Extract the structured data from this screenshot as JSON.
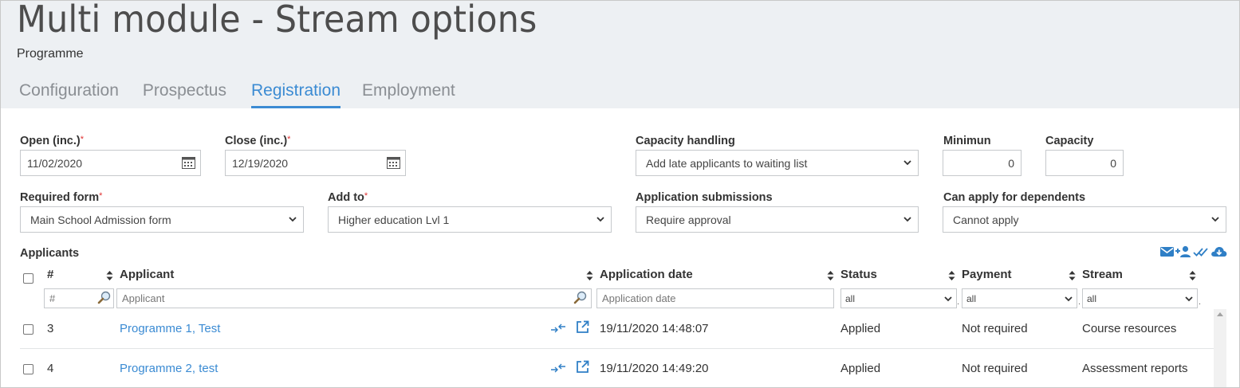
{
  "header": {
    "title": "Multi module - Stream options",
    "subtitle": "Programme",
    "tabs": [
      {
        "label": "Configuration",
        "active": false
      },
      {
        "label": "Prospectus",
        "active": false
      },
      {
        "label": "Registration",
        "active": true
      },
      {
        "label": "Employment",
        "active": false
      }
    ]
  },
  "form": {
    "open": {
      "label": "Open (inc.)",
      "required_mark": "*",
      "value": "11/02/2020"
    },
    "close": {
      "label": "Close (inc.)",
      "required_mark": "*",
      "value": "12/19/2020"
    },
    "capacity_handling": {
      "label": "Capacity handling",
      "value": "Add late applicants to waiting list"
    },
    "minimum": {
      "label": "Minimun",
      "value": "0"
    },
    "capacity": {
      "label": "Capacity",
      "value": "0"
    },
    "required_form": {
      "label": "Required form",
      "required_mark": "*",
      "value": "Main School Admission form"
    },
    "add_to": {
      "label": "Add to",
      "required_mark": "*",
      "value": "Higher education Lvl 1"
    },
    "application_submissions": {
      "label": "Application submissions",
      "value": "Require approval"
    },
    "can_apply_for_dependents": {
      "label": "Can apply for dependents",
      "value": "Cannot apply"
    }
  },
  "applicants": {
    "title": "Applicants",
    "columns": {
      "number": "#",
      "applicant": "Applicant",
      "application_date": "Application date",
      "status": "Status",
      "payment": "Payment",
      "stream": "Stream"
    },
    "filters": {
      "number_placeholder": "#",
      "applicant_placeholder": "Applicant",
      "date_placeholder": "Application date",
      "status_value": "all",
      "payment_value": "all",
      "stream_value": "all",
      "separator": "."
    },
    "rows": [
      {
        "number": "3",
        "applicant": "Programme 1, Test",
        "date": "19/11/2020 14:48:07",
        "status": "Applied",
        "payment": "Not required",
        "stream": "Course resources"
      },
      {
        "number": "4",
        "applicant": "Programme 2, test",
        "date": "19/11/2020 14:49:20",
        "status": "Applied",
        "payment": "Not required",
        "stream": "Assessment reports"
      }
    ]
  },
  "colors": {
    "accent": "#3b8bd3",
    "header_bg": "#edf0f3",
    "required": "#e03131"
  },
  "icons": {
    "toolbar": [
      "email-icon",
      "add-user-icon",
      "double-check-icon",
      "cloud-download-icon"
    ],
    "row": [
      "merge-arrows-icon",
      "open-external-icon"
    ]
  }
}
